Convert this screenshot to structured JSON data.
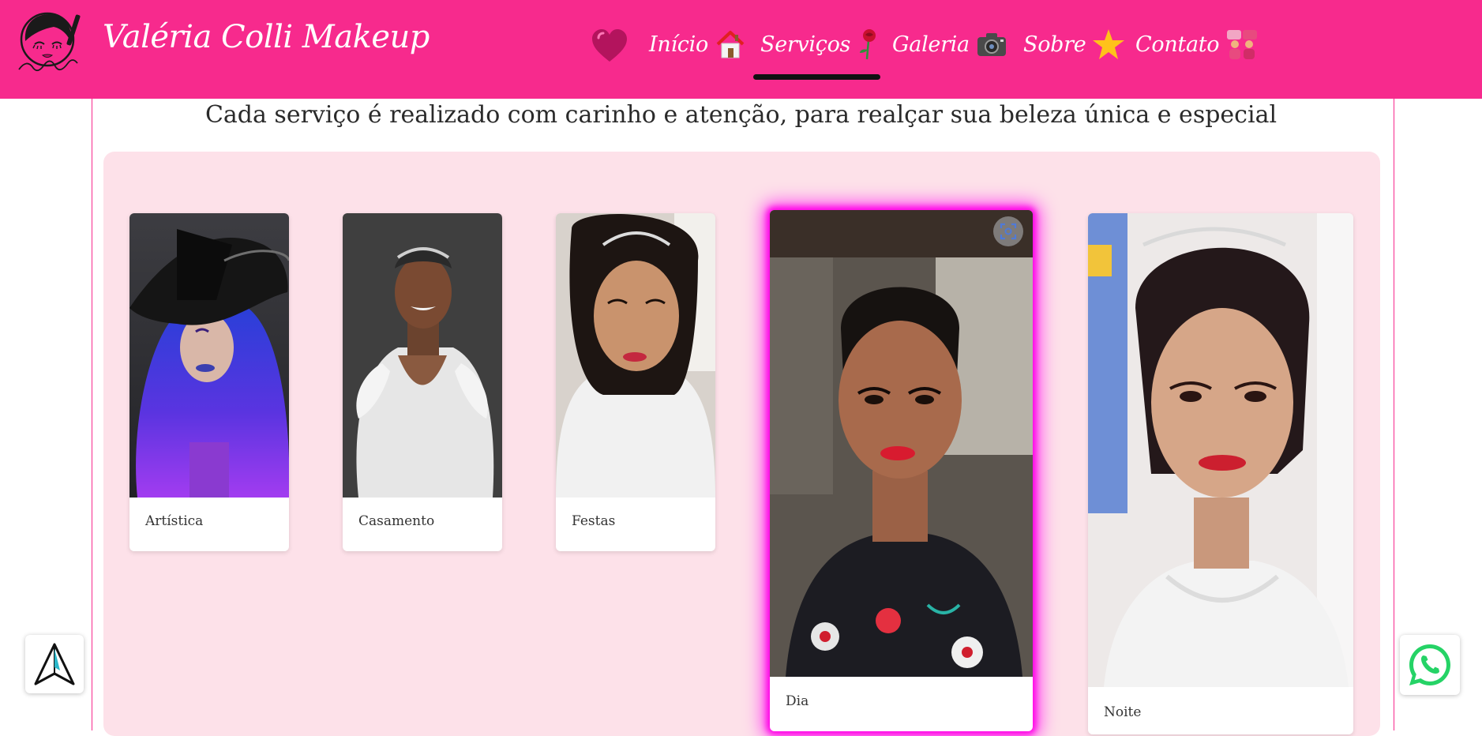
{
  "header": {
    "brand": "Valéria Colli Makeup",
    "logo_icon": "makeup-face-logo",
    "accent_color": "#f72a8d"
  },
  "nav": {
    "items": [
      {
        "label": "Início",
        "icon": "house-icon"
      },
      {
        "label": "Serviços",
        "icon": "rose-icon",
        "active": true
      },
      {
        "label": "Galeria",
        "icon": "camera-icon"
      },
      {
        "label": "Sobre",
        "icon": "star-icon"
      },
      {
        "label": "Contato",
        "icon": "people-icon"
      }
    ],
    "lead_icon": "heart-icon"
  },
  "main": {
    "subtitle": "Cada serviço é realizado com carinho e atenção, para realçar sua beleza única e especial",
    "panel_color": "#fde1e9",
    "cards": [
      {
        "caption": "Artística",
        "photo": "artistic-makeup-photo"
      },
      {
        "caption": "Casamento",
        "photo": "wedding-makeup-photo"
      },
      {
        "caption": "Festas",
        "photo": "party-makeup-photo"
      },
      {
        "caption": "Dia",
        "photo": "day-makeup-photo",
        "highlighted": true,
        "highlight_color": "#ff00e6"
      },
      {
        "caption": "Noite",
        "photo": "night-makeup-photo"
      }
    ]
  },
  "floating": {
    "left_icon": "navigation-arrow-icon",
    "right_icon": "whatsapp-icon",
    "whatsapp_color": "#25d366"
  }
}
